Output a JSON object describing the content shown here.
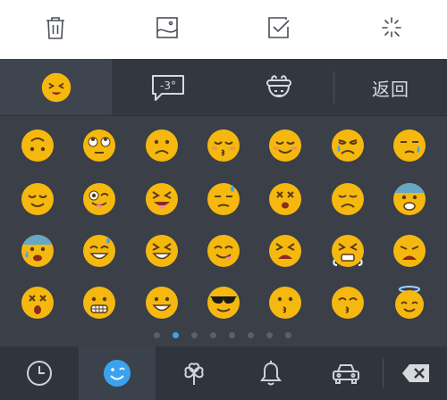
{
  "toolbar": {
    "icons": [
      "trash-icon",
      "image-icon",
      "checkbox-icon",
      "sparkle-icon"
    ]
  },
  "tabs": {
    "items": [
      "emoji-face-icon",
      "emoticon-bubble-icon",
      "character-icon"
    ],
    "back_label": "返回"
  },
  "emoji_grid": {
    "rows": [
      [
        "upside-down-face",
        "face-with-rolling-eyes",
        "frowning-face",
        "kissing-face-closed-eyes",
        "relieved-face-blush",
        "disappointed-relieved-face",
        "sleepy-face"
      ],
      [
        "relieved-face",
        "winking-tongue-face",
        "squinting-tongue-face",
        "downcast-sweat-face",
        "dizzy-face",
        "disappointed-face",
        "fearful-face"
      ],
      [
        "anxious-sweat-face",
        "grinning-sweat-face",
        "laughing-face",
        "yum-face",
        "tired-face",
        "crying-steam-face",
        "weary-face"
      ],
      [
        "astonished-dizzy-face",
        "grimacing-face",
        "grinning-face",
        "sunglasses-face",
        "kissing-face",
        "smiling-kissing-face",
        "halo-face"
      ]
    ]
  },
  "pagination": {
    "count": 8,
    "active": 1
  },
  "bottom_bar": {
    "items": [
      "clock-icon",
      "emoji-icon",
      "clover-icon",
      "bell-icon",
      "car-icon"
    ],
    "active": 1,
    "delete_icon": "backspace-icon"
  },
  "colors": {
    "keyboard_bg": "#3a3f48",
    "accent": "#3aa3f0",
    "emoji_yellow": "#f5b80f"
  }
}
